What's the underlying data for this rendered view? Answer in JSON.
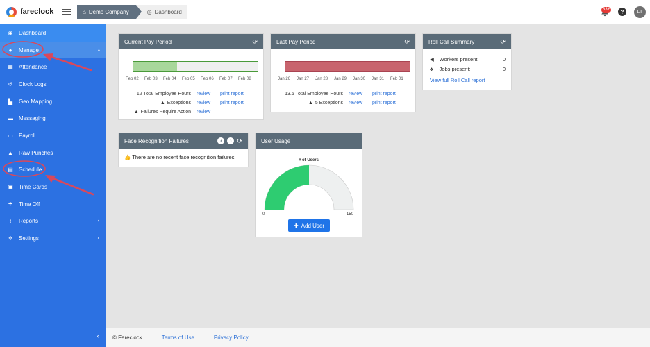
{
  "brand": {
    "name": "fareclock"
  },
  "breadcrumb": {
    "company": "Demo Company",
    "page": "Dashboard"
  },
  "header": {
    "notification_count": "33+",
    "help": "?",
    "avatar_initials": "LT"
  },
  "sidebar": {
    "items": [
      {
        "label": "Dashboard",
        "icon": "dashboard-icon"
      },
      {
        "label": "Manage",
        "icon": "user-icon"
      },
      {
        "label": "Attendance",
        "icon": "attendance-icon"
      },
      {
        "label": "Clock Logs",
        "icon": "history-icon"
      },
      {
        "label": "Geo Mapping",
        "icon": "map-icon"
      },
      {
        "label": "Messaging",
        "icon": "chat-icon"
      },
      {
        "label": "Payroll",
        "icon": "payroll-icon"
      },
      {
        "label": "Raw Punches",
        "icon": "car-icon"
      },
      {
        "label": "Schedule",
        "icon": "calendar-icon"
      },
      {
        "label": "Time Cards",
        "icon": "timecard-icon"
      },
      {
        "label": "Time Off",
        "icon": "beach-icon"
      },
      {
        "label": "Reports",
        "icon": "chart-icon"
      },
      {
        "label": "Settings",
        "icon": "gear-icon"
      }
    ],
    "manage_chevron": "›",
    "reports_chevron": "‹",
    "settings_chevron": "‹",
    "collapse": "‹"
  },
  "current_pay_period": {
    "title": "Current Pay Period",
    "progress": 0.35,
    "ticks": [
      "Feb 02",
      "Feb 03",
      "Feb 04",
      "Feb 05",
      "Feb 06",
      "Feb 07",
      "Feb 08"
    ],
    "rows": [
      {
        "label": "12 Total Employee Hours",
        "link1": "review",
        "link2": "print report"
      },
      {
        "label": "Exceptions",
        "link1": "review",
        "link2": "print report"
      },
      {
        "label": "Failures Require Action",
        "link1": "review"
      }
    ]
  },
  "last_pay_period": {
    "title": "Last Pay Period",
    "progress": 1.0,
    "ticks": [
      "Jan 26",
      "Jan 27",
      "Jan 28",
      "Jan 29",
      "Jan 30",
      "Jan 31",
      "Feb 01"
    ],
    "rows": [
      {
        "label": "13.6 Total Employee Hours",
        "link1": "review",
        "link2": "print report"
      },
      {
        "label": "5 Exceptions",
        "link1": "review",
        "link2": "print report"
      }
    ]
  },
  "roll_call": {
    "title": "Roll Call Summary",
    "workers_label": "Workers present:",
    "workers_value": "0",
    "jobs_label": "Jobs present:",
    "jobs_value": "0",
    "link": "View full Roll Call report"
  },
  "face_recognition": {
    "title": "Face Recognition Failures",
    "message": "There are no recent face recognition failures."
  },
  "user_usage": {
    "title": "User Usage",
    "chart_title": "# of Users",
    "min": "0",
    "max": "150",
    "value": 75,
    "button": "Add User"
  },
  "footer": {
    "copyright": "© Fareclock",
    "terms": "Terms of Use",
    "privacy": "Privacy Policy"
  },
  "colors": {
    "sidebar": "#2c71e2",
    "gauge_fill": "#2ecc71",
    "last_bar": "#c8646e",
    "accent": "#1f74e8"
  }
}
